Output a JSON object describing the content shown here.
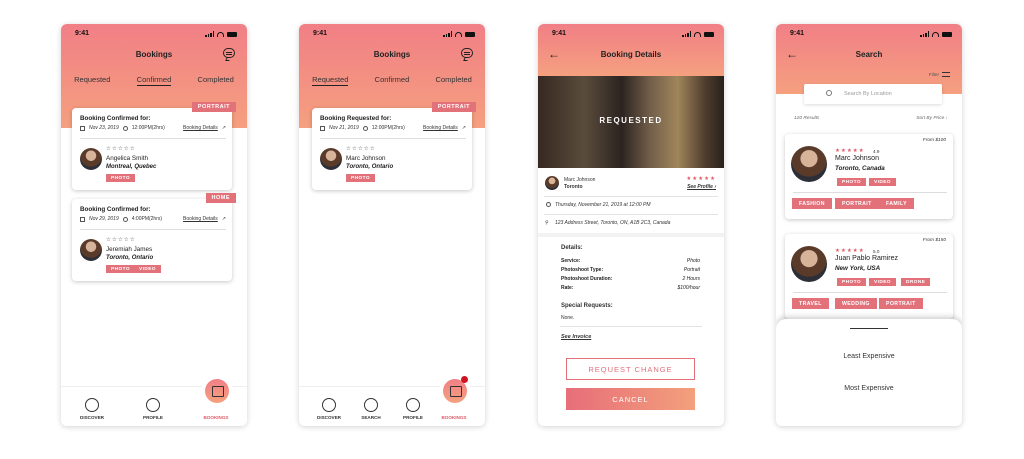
{
  "status": {
    "time": "9:41"
  },
  "screen1": {
    "title": "Bookings",
    "tabs": [
      "Requested",
      "Confirmed",
      "Completed"
    ],
    "cards": [
      {
        "tag": "PORTRAIT",
        "heading": "Booking Confirmed for:",
        "date": "Nov 23, 2019",
        "time": "12:00PM(2hrs)",
        "link": "Booking Details",
        "name": "Angelica Smith",
        "location": "Montreal, Quebec",
        "services": [
          "PHOTO"
        ]
      },
      {
        "tag": "HOME",
        "heading": "Booking Confirmed for:",
        "date": "Nov 29, 2019",
        "time": "4:00PM(2hrs)",
        "link": "Booking Details",
        "name": "Jeremiah James",
        "location": "Toronto, Ontario",
        "services": [
          "PHOTO",
          "VIDEO"
        ]
      }
    ],
    "nav": [
      "DISCOVER",
      "PROFILE",
      "BOOKINGS"
    ]
  },
  "screen2": {
    "title": "Bookings",
    "tabs": [
      "Requested",
      "Confirmed",
      "Completed"
    ],
    "card": {
      "tag": "PORTRAIT",
      "heading": "Booking Requested for:",
      "date": "Nov 21, 2019",
      "time": "12:00PM(2hrs)",
      "link": "Booking Details",
      "name": "Marc Johnson",
      "location": "Toronto, Ontario",
      "services": [
        "PHOTO"
      ]
    },
    "nav": [
      "DISCOVER",
      "SEARCH",
      "PROFILE",
      "BOOKINGS"
    ]
  },
  "screen3": {
    "title": "Booking Details",
    "status_label": "REQUESTED",
    "photographer": {
      "name": "Marc Johnson",
      "city": "Toronto",
      "link": "See Profile"
    },
    "datetime": "Thursday, November 21, 2019 at 12:00 PM",
    "address": "123 Address Street, Toronto, ON, A1B 2C3, Canada",
    "details_heading": "Details:",
    "details": [
      {
        "k": "Service:",
        "v": "Photo"
      },
      {
        "k": "Photoshoot Type:",
        "v": "Portrait"
      },
      {
        "k": "Photoshoot Duration:",
        "v": "2 Hours"
      },
      {
        "k": "Rate:",
        "v": "$100/hour"
      }
    ],
    "special_heading": "Special Requests:",
    "special_value": "None.",
    "invoice_link": "See Invoice",
    "btn_change": "REQUEST CHANGE",
    "btn_cancel": "CANCEL"
  },
  "screen4": {
    "title": "Search",
    "filter": "Filter",
    "search_placeholder": "Search By Location",
    "results": "120 Results",
    "sort": "Sort By Price",
    "results_list": [
      {
        "price": "From $100",
        "rating": "4.9",
        "name": "Marc Johnson",
        "location": "Toronto, Canada",
        "services": [
          "PHOTO",
          "VIDEO"
        ],
        "categories": [
          "FASHION",
          "PORTRAIT",
          "FAMILY"
        ]
      },
      {
        "price": "From $150",
        "rating": "5.0",
        "name": "Juan Pablo Ramirez",
        "location": "New York, USA",
        "services": [
          "PHOTO",
          "VIDEO",
          "DRONE"
        ],
        "categories": [
          "TRAVEL",
          "WEDDING",
          "PORTRAIT"
        ]
      }
    ],
    "sort_options": [
      "Least Expensive",
      "Most Expensive"
    ]
  },
  "colors": {
    "accent": "#e2717a",
    "gradient_start": "#f17f86",
    "gradient_end": "#f5a07f",
    "notification": "#d0141f"
  },
  "icons": [
    "chat-icon",
    "back-arrow-icon",
    "calendar-icon",
    "clock-icon",
    "external-link-icon",
    "compass-icon",
    "profile-icon",
    "search-icon",
    "filter-icon",
    "pin-icon",
    "star-icon"
  ]
}
